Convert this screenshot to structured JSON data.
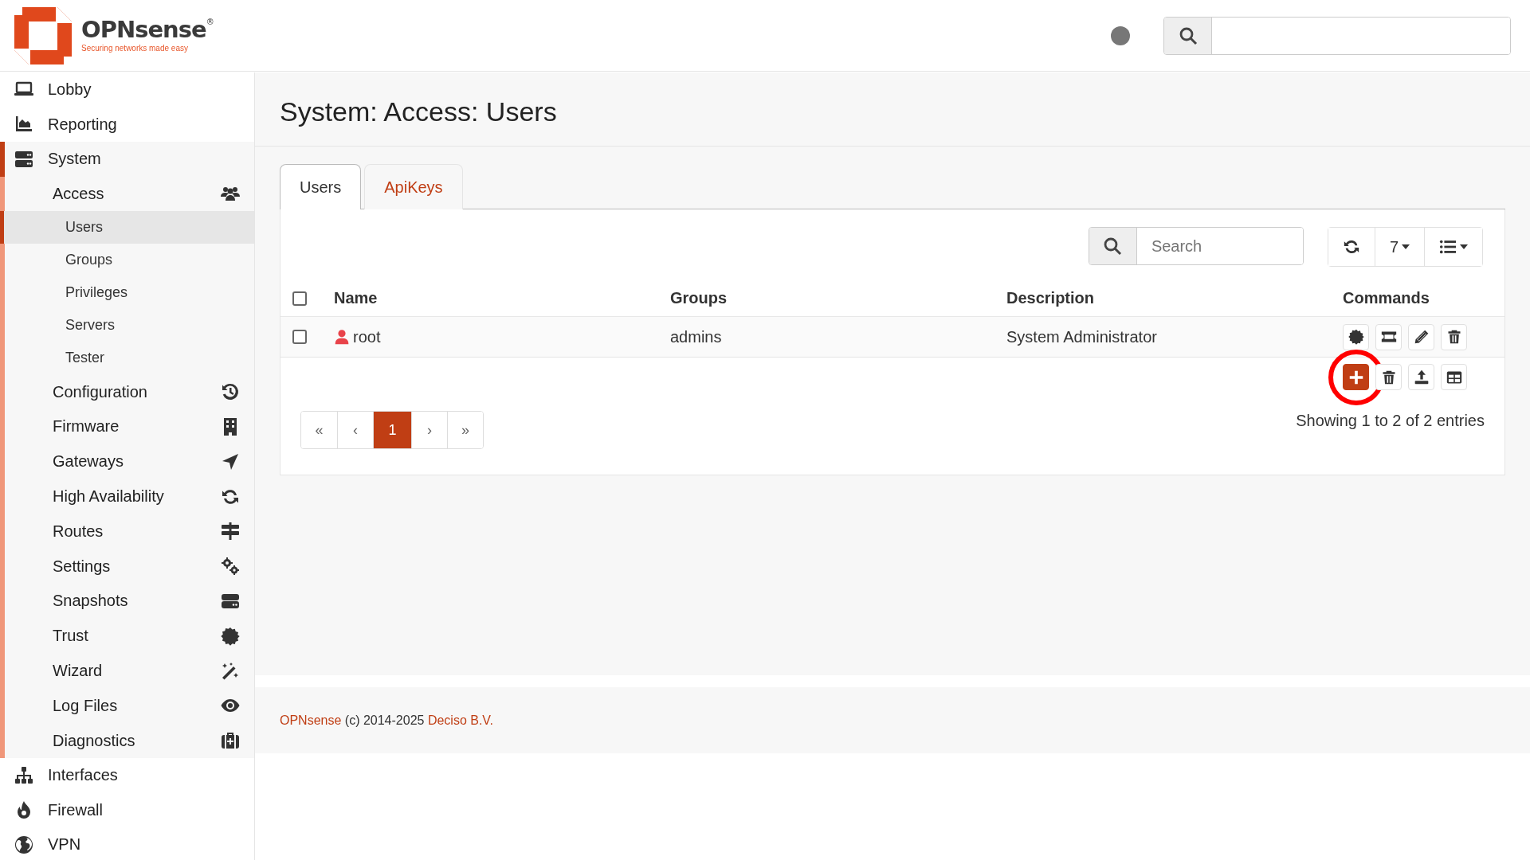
{
  "header": {
    "logo": {
      "name": "OPNsense",
      "mark": "®",
      "tagline": "Securing networks made easy"
    }
  },
  "sidebar": {
    "items": [
      {
        "label": "Lobby"
      },
      {
        "label": "Reporting"
      },
      {
        "label": "System",
        "expanded": true,
        "children": [
          {
            "label": "Access",
            "expanded": true,
            "children": [
              {
                "label": "Users",
                "selected": true
              },
              {
                "label": "Groups",
                "selected": false
              },
              {
                "label": "Privileges",
                "selected": false
              },
              {
                "label": "Servers",
                "selected": false
              },
              {
                "label": "Tester",
                "selected": false
              }
            ]
          },
          {
            "label": "Configuration"
          },
          {
            "label": "Firmware"
          },
          {
            "label": "Gateways"
          },
          {
            "label": "High Availability"
          },
          {
            "label": "Routes"
          },
          {
            "label": "Settings"
          },
          {
            "label": "Snapshots"
          },
          {
            "label": "Trust"
          },
          {
            "label": "Wizard"
          },
          {
            "label": "Log Files"
          },
          {
            "label": "Diagnostics"
          }
        ]
      },
      {
        "label": "Interfaces"
      },
      {
        "label": "Firewall"
      },
      {
        "label": "VPN"
      }
    ]
  },
  "page_title": "System: Access: Users",
  "tabs": [
    {
      "label": "Users",
      "selected": true
    },
    {
      "label": "ApiKeys",
      "selected": false
    }
  ],
  "grid": {
    "search": {
      "placeholder": "Search"
    },
    "page_size": "7",
    "columns": [
      "Name",
      "Groups",
      "Description",
      "Commands"
    ],
    "select_all": {
      "checked": false
    },
    "rows": [
      {
        "checked": false,
        "name": "root",
        "groups": "admins",
        "description": "System Administrator"
      }
    ],
    "footer_commands": [
      {
        "kind": "add",
        "highlighted": true
      },
      {
        "kind": "delete",
        "highlighted": false
      },
      {
        "kind": "upload",
        "highlighted": false
      },
      {
        "kind": "table",
        "highlighted": false
      }
    ],
    "pages": [
      {
        "label": "«",
        "selected": false
      },
      {
        "label": "‹",
        "selected": false
      },
      {
        "label": "1",
        "selected": true
      },
      {
        "label": "›",
        "selected": false
      },
      {
        "label": "»",
        "selected": false
      }
    ],
    "info": "Showing 1 to 2 of 2 entries"
  },
  "footer": {
    "brand_link": "OPNsense",
    "copyright": "(c) 2014-2025",
    "company_link": "Deciso B.V."
  }
}
